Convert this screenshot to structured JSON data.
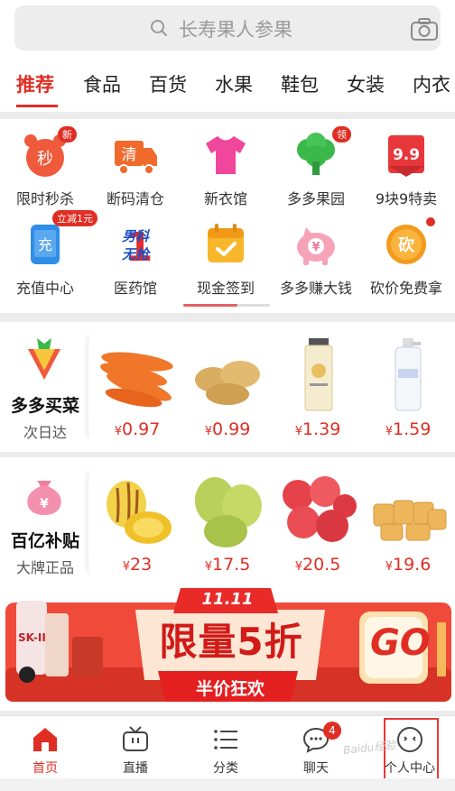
{
  "search": {
    "placeholder": "长寿果人参果"
  },
  "tabs": [
    "推荐",
    "食品",
    "百货",
    "水果",
    "鞋包",
    "女装",
    "内衣"
  ],
  "grid": [
    {
      "label": "限时秒杀",
      "badge": "新",
      "icon_text": "秒",
      "icon": "stopwatch-icon"
    },
    {
      "label": "断码清仓",
      "icon_text": "清",
      "icon": "truck-icon"
    },
    {
      "label": "新衣馆",
      "icon": "tshirt-icon"
    },
    {
      "label": "多多果园",
      "badge": "领",
      "icon": "tree-icon"
    },
    {
      "label": "9块9特卖",
      "icon_text": "9.9",
      "icon": "price-tag-icon"
    },
    {
      "label": "充值中心",
      "badge": "立减1元",
      "icon_text": "充",
      "icon": "phone-recharge-icon"
    },
    {
      "label": "医药馆",
      "icon_text": "男科 无抢",
      "icon": "medicine-icon"
    },
    {
      "label": "现金签到",
      "icon": "calendar-check-icon"
    },
    {
      "label": "多多赚大钱",
      "icon_text": "¥",
      "icon": "piggy-bank-icon"
    },
    {
      "label": "砍价免费拿",
      "icon_text": "砍",
      "icon": "bargain-coin-icon"
    }
  ],
  "rows": [
    {
      "title": "多多买菜",
      "subtitle": "次日达",
      "logo": "carrot-bag-icon",
      "products": [
        {
          "name": "carrots",
          "price": "0.97"
        },
        {
          "name": "potatoes",
          "price": "0.99"
        },
        {
          "name": "cream-tube",
          "price": "1.39"
        },
        {
          "name": "spray-bottle",
          "price": "1.59"
        }
      ]
    },
    {
      "title": "百亿补贴",
      "subtitle": "大牌正品",
      "logo": "money-bag-icon",
      "logo_text": "¥",
      "products": [
        {
          "name": "pepino-melon",
          "price": "23"
        },
        {
          "name": "pears",
          "price": "17.5"
        },
        {
          "name": "apples",
          "price": "20.5"
        },
        {
          "name": "pastries",
          "price": "19.6"
        }
      ]
    }
  ],
  "currency": "¥",
  "banner": {
    "date": "11.11",
    "title": "限量5折",
    "subtitle": "半价狂欢",
    "cta": "GO",
    "brand": "SK-II"
  },
  "nav": [
    {
      "label": "首页",
      "icon": "home-icon",
      "active": true
    },
    {
      "label": "直播",
      "icon": "tv-icon"
    },
    {
      "label": "分类",
      "icon": "list-icon"
    },
    {
      "label": "聊天",
      "icon": "chat-icon",
      "badge": "4"
    },
    {
      "label": "个人中心",
      "icon": "profile-icon"
    }
  ],
  "watermark": "Baidu经验",
  "colors": {
    "accent": "#e02e24",
    "background": "#ebebeb"
  }
}
